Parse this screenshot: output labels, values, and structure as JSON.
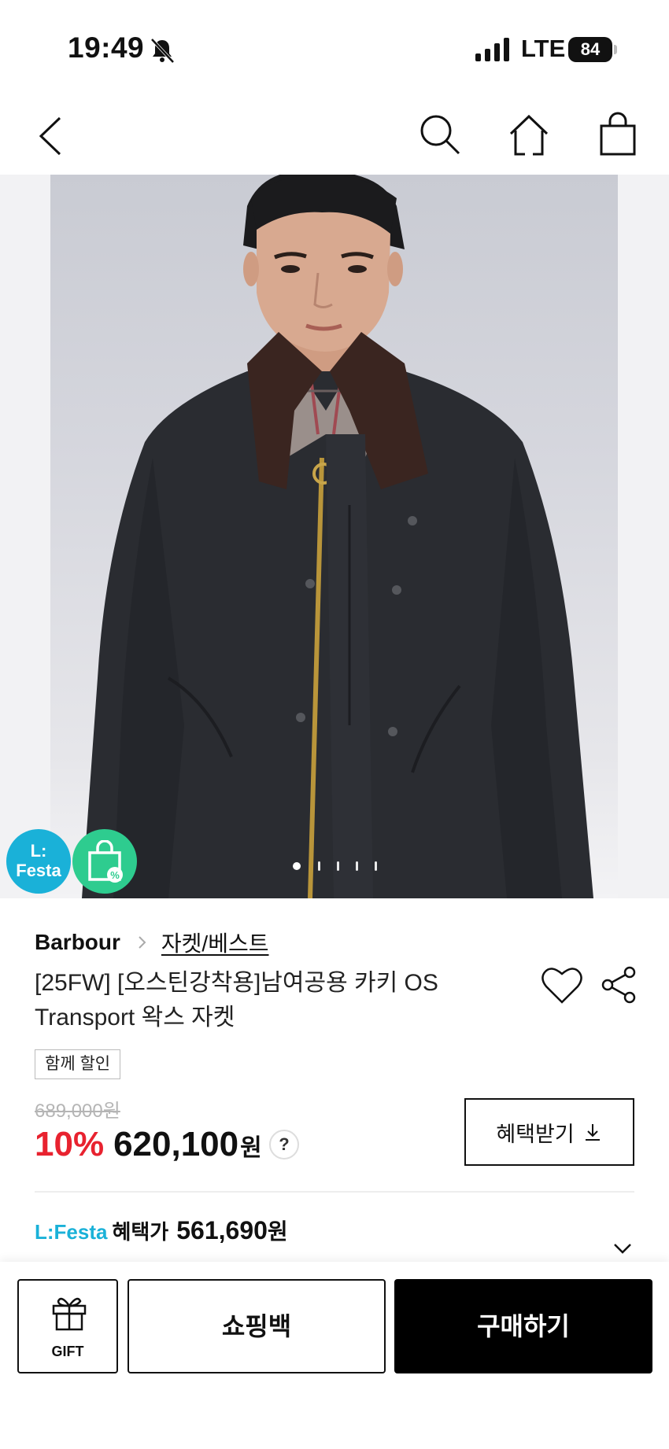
{
  "status_bar": {
    "time": "19:49",
    "network": "LTE",
    "battery": "84",
    "icons": [
      "bell-slash-icon",
      "signal-icon"
    ]
  },
  "nav": {
    "icons": [
      "back-icon",
      "search-icon",
      "home-icon",
      "shopping-bag-icon"
    ]
  },
  "image": {
    "badges": {
      "festa": "L:\nFesta",
      "coupon_icon": "coupon-bag-icon"
    },
    "slide_count": 5,
    "active_slide": 1
  },
  "product": {
    "brand": "Barbour",
    "category": "자켓/베스트",
    "title": "[25FW] [오스틴강착용]남여공용 카키 OS Transport 왁스 자켓",
    "bundle_badge": "함께 할인",
    "original_price": "689,000원",
    "discount_rate": "10%",
    "sale_price": "620,100",
    "currency_unit": "원",
    "help_label": "?",
    "benefit_button": "혜택받기"
  },
  "festa": {
    "logo": "L:Festa",
    "label": "혜택가",
    "price": "561,690",
    "unit": "원"
  },
  "bottom_bar": {
    "gift_label": "GIFT",
    "cart_label": "쇼핑백",
    "buy_label": "구매하기"
  },
  "colors": {
    "discount": "#e8222f",
    "festa_blue": "#1ab1d8",
    "coupon_green": "#2ecc8f",
    "primary": "#000000"
  }
}
